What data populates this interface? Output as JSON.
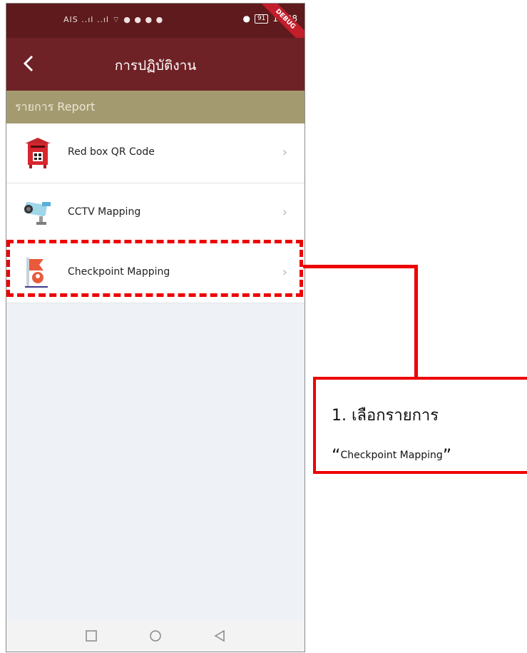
{
  "status_bar": {
    "left_text": "AIS ..ıl ..ıl ⌔ ● ● ● ●",
    "battery": "91",
    "time": "14:28",
    "debug_banner": "DEBUG"
  },
  "app_bar": {
    "title": "การปฏิบัติงาน"
  },
  "section": {
    "header": "รายการ Report"
  },
  "list_items": [
    {
      "label": "Red box QR Code",
      "icon": "red-mailbox-qr-icon"
    },
    {
      "label": "CCTV Mapping",
      "icon": "cctv-camera-icon"
    },
    {
      "label": "Checkpoint Mapping",
      "icon": "checkpoint-map-pin-icon"
    }
  ],
  "callout": {
    "step_text": "1. เลือกรายการ",
    "quote_open": "“",
    "quote_text": "Checkpoint Mapping",
    "quote_close": "”"
  },
  "colors": {
    "status_bar": "#5e1a1c",
    "app_bar": "#6f2226",
    "section_header": "#a39a70",
    "highlight": "#ee0000"
  }
}
